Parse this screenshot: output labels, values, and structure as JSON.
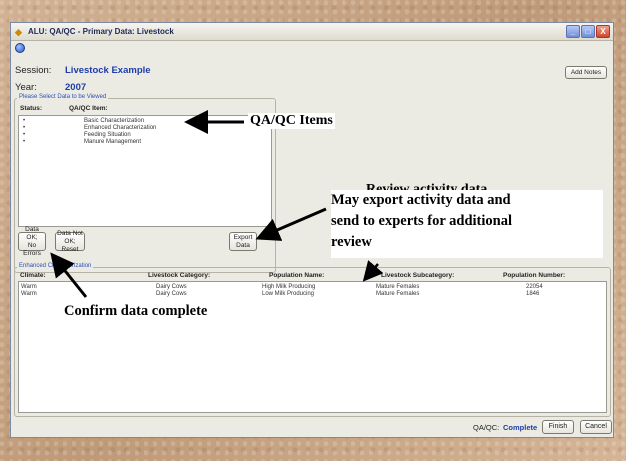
{
  "window": {
    "title": "ALU: QA/QC - Primary Data: Livestock",
    "controls": [
      "_",
      "□",
      "X"
    ]
  },
  "session": {
    "label": "Session:",
    "value": "Livestock Example"
  },
  "year": {
    "label": "Year:",
    "value": "2007"
  },
  "add_notes_label": "Add Notes",
  "select_group": {
    "legend": "Please Select Data to be Viewed",
    "columns": [
      "Status:",
      "QA/QC Item:"
    ],
    "items": [
      {
        "status": "•",
        "name": "Basic Characterization"
      },
      {
        "status": "•",
        "name": "Enhanced Characterization"
      },
      {
        "status": "•",
        "name": "Feeding Situation"
      },
      {
        "status": "•",
        "name": "Manure Management"
      }
    ],
    "buttons": {
      "data_ok": [
        "Data OK;",
        "No Errors"
      ],
      "data_not_ok": [
        "Data Not",
        "OK; Reset"
      ],
      "export": [
        "Export",
        "Data"
      ]
    }
  },
  "detail_group": {
    "legend": "Enhanced Characterization",
    "columns": [
      "Climate:",
      "Livestock Category:",
      "Population Name:",
      "Livestock Subcategory:",
      "Population Number:"
    ],
    "rows": [
      [
        "Warm",
        "Dairy Cows",
        "High Milk Producing",
        "Mature Females",
        "22054"
      ],
      [
        "Warm",
        "Dairy Cows",
        "Low Milk Producing",
        "Mature Females",
        "1846"
      ]
    ]
  },
  "footer": {
    "qaqc_label": "QA/QC:",
    "qaqc_status": "Complete",
    "finish_label": "Finish",
    "cancel_label": "Cancel"
  },
  "annotations": {
    "qaqc_items": "QA/QC Items",
    "partial_hidden": "Review activity data",
    "export_line1": "May export activity data and",
    "export_line2": "send to experts for additional",
    "export_line3": "review",
    "confirm": "Confirm data complete"
  }
}
